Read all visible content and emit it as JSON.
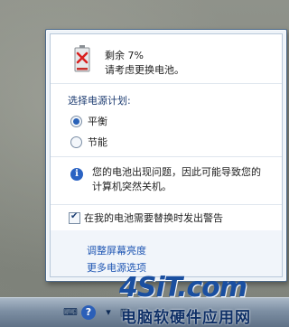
{
  "battery": {
    "remaining_label": "剩余 7%",
    "message": "请考虑更换电池。"
  },
  "power_plan": {
    "title": "选择电源计划:",
    "options": [
      {
        "label": "平衡",
        "selected": true
      },
      {
        "label": "节能",
        "selected": false
      }
    ]
  },
  "warning": {
    "line1": "您的电池出现问题，因此可能导致您的",
    "line2": "计算机突然关机。"
  },
  "replace_warning_checkbox": {
    "label": "在我的电池需要替换时发出警告",
    "checked": true
  },
  "links": {
    "adjust_brightness": "调整屏幕亮度",
    "more_power_options": "更多电源选项"
  },
  "watermark": {
    "logo_text": "4SiT.com",
    "subtitle": "电脑软硬件应用网"
  },
  "colors": {
    "link": "#1f56b3",
    "heading": "#1e3d72",
    "battery_warning": "#d9201f"
  }
}
